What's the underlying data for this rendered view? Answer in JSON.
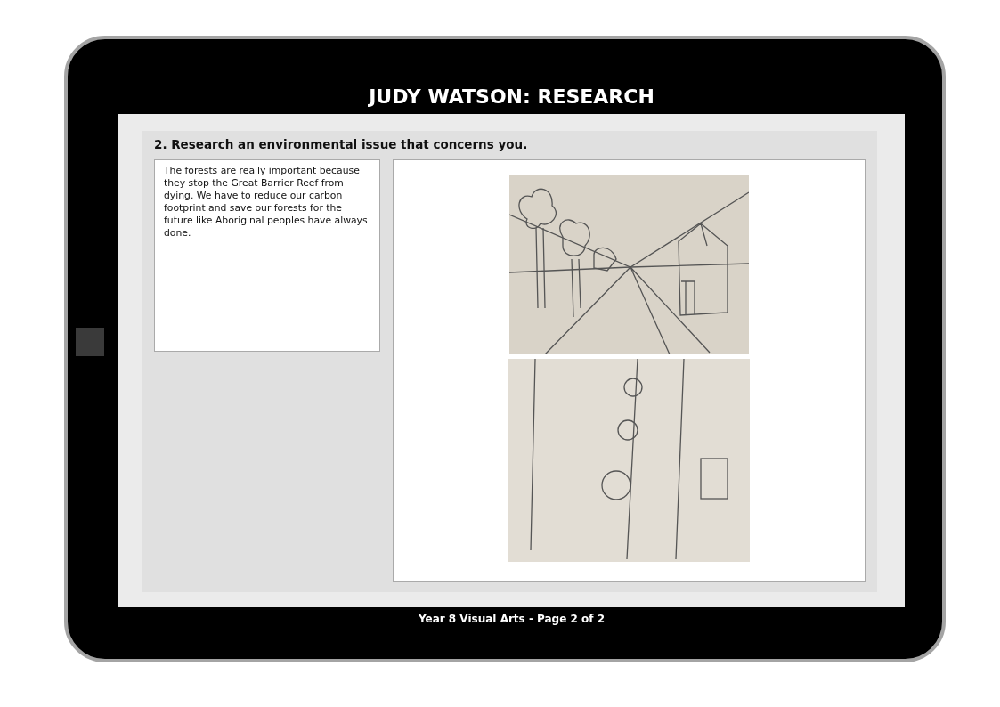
{
  "header": {
    "title": "JUDY WATSON: RESEARCH"
  },
  "question": {
    "label": "2. Research an environmental issue that concerns you.",
    "answer": "The forests are really important because they stop the Great Barrier Reef from dying. We have to reduce our carbon footprint and save our forests for the future like Aboriginal peoples have always done."
  },
  "footer": {
    "text": "Year 8 Visual Arts - Page 2 of 2"
  }
}
